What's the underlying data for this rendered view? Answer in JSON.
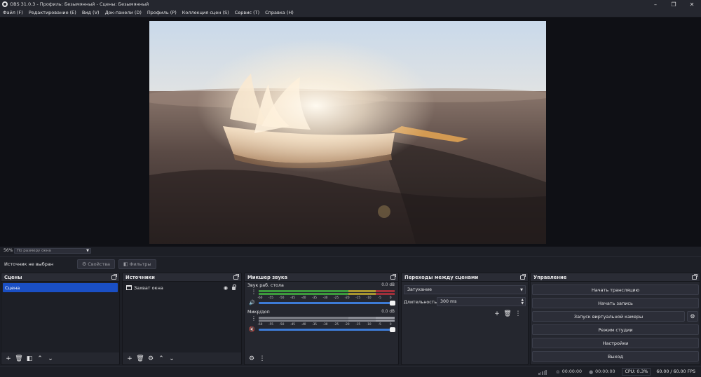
{
  "window": {
    "title": "OBS 31.0.3 - Профиль: Безымянный - Сцены: Безымянный",
    "min_icon": "minimize-icon",
    "max_icon": "maximize-icon",
    "close_icon": "close-icon"
  },
  "menu": [
    "Файл (F)",
    "Редактирование (E)",
    "Вид (V)",
    "Док-панели (D)",
    "Профиль (P)",
    "Коллекция сцен (S)",
    "Сервис (T)",
    "Справка (H)"
  ],
  "zoom": {
    "percent": "56%",
    "mode": "По размеру окна"
  },
  "source_bar": {
    "status": "Источник не выбран",
    "properties_label": "Свойства",
    "filters_label": "Фильтры"
  },
  "scenes": {
    "title": "Сцены",
    "items": [
      "Сцена"
    ]
  },
  "sources": {
    "title": "Источники",
    "items": [
      "Захват окна"
    ]
  },
  "mixer": {
    "title": "Микшер звука",
    "channels": [
      {
        "name": "Звук раб. стола",
        "db": "0.0 dB",
        "muted": false
      },
      {
        "name": "Микр/доп",
        "db": "0.0 dB",
        "muted": true
      }
    ],
    "ticks": [
      "-60",
      "-55",
      "-50",
      "-45",
      "-40",
      "-35",
      "-30",
      "-25",
      "-20",
      "-15",
      "-10",
      "-5",
      "0"
    ]
  },
  "transitions": {
    "title": "Переходы между сценами",
    "selected": "Затухание",
    "duration_label": "Длительность",
    "duration_value": "300 ms"
  },
  "controls": {
    "title": "Управление",
    "buttons": [
      "Начать трансляцию",
      "Начать запись",
      "Запуск виртуальной камеры",
      "Режим студии",
      "Настройки",
      "Выход"
    ]
  },
  "status": {
    "stream_time": "00:00:00",
    "record_time": "00:00:00",
    "cpu": "CPU: 0.3%",
    "fps": "60.00 / 60.00 FPS"
  },
  "colors": {
    "accent": "#1a4fc4",
    "fader": "#3d7bd6",
    "muted": "#e0485a"
  }
}
